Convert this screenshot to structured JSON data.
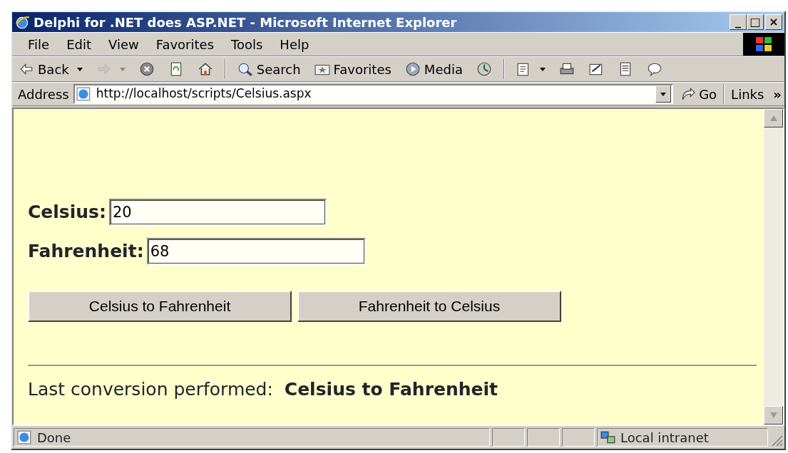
{
  "window": {
    "title": "Delphi for .NET does ASP.NET - Microsoft Internet Explorer",
    "controls": [
      "_",
      "□",
      "×"
    ]
  },
  "menu": [
    "File",
    "Edit",
    "View",
    "Favorites",
    "Tools",
    "Help"
  ],
  "toolbar": [
    {
      "kind": "text",
      "label": "Back",
      "dropdown": true,
      "disabled": false
    },
    {
      "kind": "icon",
      "dropdown": true,
      "disabled": true
    },
    {
      "kind": "icon",
      "dropdown": false,
      "disabled": false
    },
    {
      "kind": "icon",
      "dropdown": false,
      "disabled": false
    },
    {
      "kind": "icon",
      "dropdown": false,
      "disabled": false
    },
    {
      "kind": "separator"
    },
    {
      "kind": "text",
      "label": "Search",
      "dropdown": false,
      "disabled": false
    },
    {
      "kind": "text",
      "label": "Favorites",
      "dropdown": false,
      "disabled": false
    },
    {
      "kind": "text",
      "label": "Media",
      "dropdown": false,
      "disabled": false
    },
    {
      "kind": "icon",
      "dropdown": false,
      "disabled": false
    },
    {
      "kind": "separator"
    },
    {
      "kind": "icon",
      "dropdown": true,
      "disabled": false
    },
    {
      "kind": "icon",
      "dropdown": false,
      "disabled": false
    },
    {
      "kind": "icon",
      "dropdown": false,
      "disabled": false
    },
    {
      "kind": "icon",
      "dropdown": false,
      "disabled": false
    },
    {
      "kind": "icon",
      "dropdown": false,
      "disabled": false
    }
  ],
  "address": {
    "label": "Address",
    "value": "http://localhost/scripts/Celsius.aspx",
    "go": "Go",
    "links": "Links",
    "links_more": "»"
  },
  "form": {
    "fields": [
      {
        "label": "Celsius:",
        "value": "20"
      },
      {
        "label": "Fahrenheit:",
        "value": "68"
      }
    ],
    "buttons": [
      "Celsius to Fahrenheit",
      "Fahrenheit to Celsius"
    ],
    "result": "Last conversion performed:  **Celsius to Fahrenheit**"
  },
  "status_bar": {
    "text": "Done",
    "zone": "Local intranet"
  }
}
